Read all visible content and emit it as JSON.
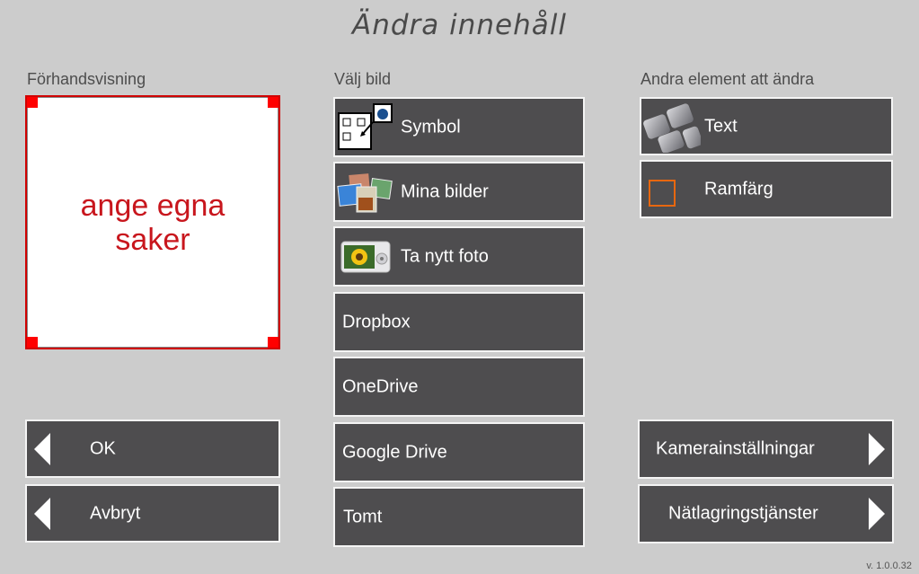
{
  "title": "Ändra innehåll",
  "preview": {
    "label": "Förhandsvisning",
    "text_line1": "ange egna",
    "text_line2": "saker",
    "text_color": "#c8161d",
    "frame_color": "#ff0000"
  },
  "image_source": {
    "label": "Välj bild",
    "buttons": [
      {
        "label": "Symbol",
        "icon": "symbol-icon"
      },
      {
        "label": "Mina bilder",
        "icon": "photos-icon"
      },
      {
        "label": "Ta nytt foto",
        "icon": "camera-icon"
      },
      {
        "label": "Dropbox"
      },
      {
        "label": "OneDrive"
      },
      {
        "label": "Google Drive"
      },
      {
        "label": "Tomt"
      }
    ]
  },
  "other_elements": {
    "label": "Andra element att ändra",
    "buttons": [
      {
        "label": "Text",
        "icon": "keyboard-icon"
      },
      {
        "label": "Ramfärg",
        "icon": "frame-color-swatch-icon",
        "swatch_color": "#e8670f"
      }
    ]
  },
  "actions": {
    "ok": "OK",
    "cancel": "Avbryt",
    "camera_settings": "Kamerainställningar",
    "cloud_services": "Nätlagringstjänster"
  },
  "version": "v. 1.0.0.32"
}
